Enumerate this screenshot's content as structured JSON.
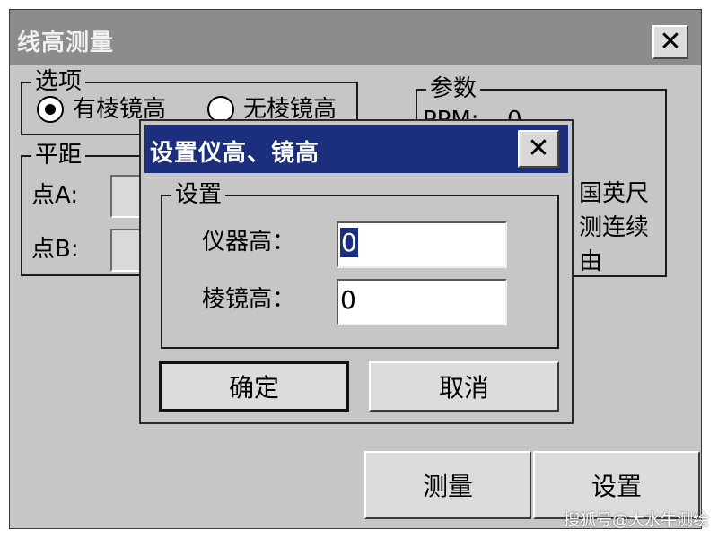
{
  "main_window": {
    "title": "线高测量",
    "close_glyph": "✕",
    "options_group": {
      "legend": "选项",
      "radio_with_prism": "有棱镜高",
      "radio_without_prism": "无棱镜高",
      "selected": "有棱镜高"
    },
    "distance_group": {
      "legend": "平距",
      "point_a_label": "点A:",
      "point_b_label": "点B:"
    },
    "params_group": {
      "legend": "参数",
      "ppm_label": "PPM:",
      "ppm_value": "0",
      "line1": "国英尺",
      "line2": "测连续",
      "line3": "由"
    },
    "measure_button": "测量",
    "settings_button": "设置"
  },
  "dialog": {
    "title": "设置仪高、镜高",
    "close_glyph": "✕",
    "group_legend": "设置",
    "instrument_height_label": "仪器高：",
    "instrument_height_value": "0",
    "prism_height_label": "棱镜高：",
    "prism_height_value": "0",
    "ok_button": "确定",
    "cancel_button": "取消"
  },
  "watermark": "搜狐号@大水牛测绘",
  "colors": {
    "window_bg": "#c6c6c6",
    "main_title_bar": "#8c8c8c",
    "dialog_title_bar": "#1b2f7c"
  }
}
